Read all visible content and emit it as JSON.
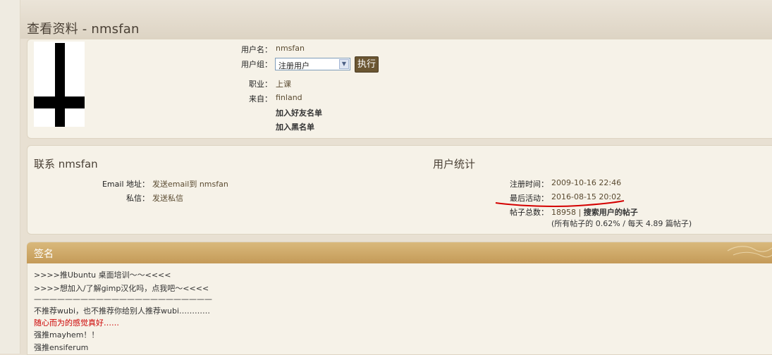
{
  "page_title": "查看资料 - nmsfan",
  "profile": {
    "username_label": "用户名：",
    "username": "nmsfan",
    "group_label": "用户组：",
    "group_selected": "注册用户",
    "exec_button": "执行",
    "occupation_label": "职业：",
    "occupation": "上课",
    "from_label": "来自：",
    "from": "finland",
    "add_friend": "加入好友名单",
    "add_blacklist": "加入黑名单"
  },
  "contact": {
    "heading": "联系 nmsfan",
    "email_label": "Email 地址：",
    "email_link": "发送email到 nmsfan",
    "pm_label": "私信：",
    "pm_link": "发送私信"
  },
  "stats": {
    "heading": "用户统计",
    "registered_label": "注册时间：",
    "registered": "2009-10-16 22:46",
    "last_active_label": "最后活动：",
    "last_active": "2016-08-15 20:02",
    "posts_label": "帖子总数：",
    "posts": "18958",
    "sep": "|",
    "search_posts": "搜索用户的帖子",
    "posts_detail": "(所有帖子的 0.62% / 每天 4.89 篇帖子)"
  },
  "signature": {
    "heading": "签名",
    "lines": [
      ">>>>推Ubuntu 桌面培训～～<<<<",
      ">>>>想加入/了解gimp汉化吗，点我吧～<<<<",
      "———————————————————————",
      "不推荐wubi，也不推荐你给别人推荐wubi…………",
      "随心而为的感觉真好……",
      "强推mayhem！！",
      "强推ensiferum"
    ]
  },
  "colors": {
    "accent_brown": "#6b5632",
    "sig_bar": "#c49a58",
    "annotation_red": "#cc0000"
  }
}
